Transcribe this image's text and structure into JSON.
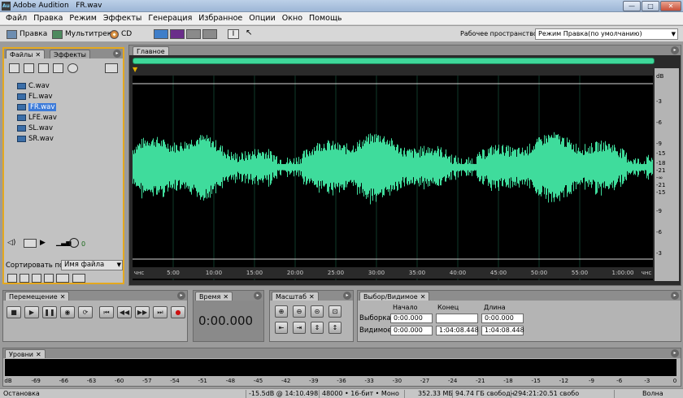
{
  "window": {
    "app_name": "Adobe Audition",
    "file_name": "FR.wav",
    "icon_text": "Au",
    "min": "—",
    "max": "□",
    "close": "✕"
  },
  "menu": [
    "Файл",
    "Правка",
    "Режим",
    "Эффекты",
    "Генерация",
    "Избранное",
    "Опции",
    "Окно",
    "Помощь"
  ],
  "toolbar": {
    "edit_label": "Правка",
    "multitrack_label": "Мультитрек",
    "cd_label": "CD",
    "workspace_label": "Рабочее пространство:",
    "workspace_value": "Режим Правка(по умолчанию)"
  },
  "files_panel": {
    "tab_files": "Файлы",
    "tab_effects": "Эффекты",
    "files": [
      "C.wav",
      "FL.wav",
      "FR.wav",
      "LFE.wav",
      "SL.wav",
      "SR.wav"
    ],
    "selected_index": 2,
    "sort_label": "Сортировать по:",
    "sort_value": "Имя файла",
    "volume_indicator": "0"
  },
  "main_panel": {
    "tab_label": "Главное",
    "db_ticks": [
      "dB",
      "-3",
      "-6",
      "-9",
      "-15",
      "-18",
      "-21",
      "-∞",
      "-21",
      "-15",
      "-9",
      "-6",
      "-3"
    ],
    "timeline_labels": [
      "чнс",
      "5:00",
      "10:00",
      "15:00",
      "20:00",
      "25:00",
      "30:00",
      "35:00",
      "40:00",
      "45:00",
      "50:00",
      "55:00",
      "1:00:00",
      "чнс"
    ],
    "colors": {
      "waveform": "#3fdc9c",
      "background": "#000000",
      "grid": "#0f3a2a"
    }
  },
  "transport": {
    "tab_label": "Перемещение"
  },
  "time_panel": {
    "tab_label": "Время",
    "value": "0:00.000"
  },
  "zoom_panel": {
    "tab_label": "Масштаб"
  },
  "selection_panel": {
    "tab_label": "Выбор/Видимое",
    "col_start": "Начало",
    "col_end": "Конец",
    "col_length": "Длина",
    "row_selection": "Выборка",
    "row_view": "Видимое",
    "sel_start": "0:00.000",
    "sel_end": "",
    "sel_length": "0:00.000",
    "view_start": "0:00.000",
    "view_end": "1:04:08.448",
    "view_length": "1:04:08.448"
  },
  "levels_panel": {
    "tab_label": "Уровни",
    "scale": [
      "dB",
      "-69",
      "-66",
      "-63",
      "-60",
      "-57",
      "-54",
      "-51",
      "-48",
      "-45",
      "-42",
      "-39",
      "-36",
      "-33",
      "-30",
      "-27",
      "-24",
      "-21",
      "-18",
      "-15",
      "-12",
      "-9",
      "-6",
      "-3",
      "0"
    ]
  },
  "status": {
    "state": "Остановка",
    "level": "-15.5dB @ 14:10.498",
    "format": "48000 • 16-бит • Моно",
    "size": "352.33 МБ",
    "free": "94.74 ГБ свободн",
    "free_time": "294:21:20.51 свобо",
    "mode": "Волна"
  }
}
